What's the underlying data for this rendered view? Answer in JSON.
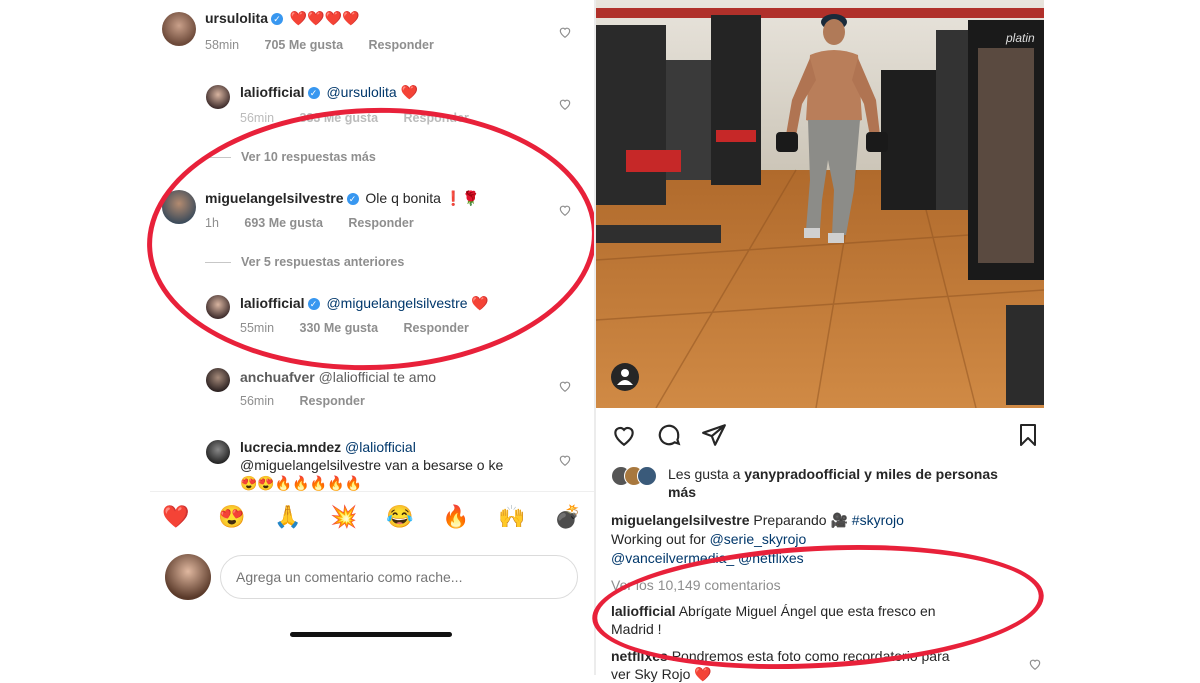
{
  "left": {
    "comments": [
      {
        "user": "ursulolita",
        "text": "❤️❤️❤️❤️",
        "time": "58min",
        "likes": "705 Me gusta",
        "reply": "Responder"
      },
      {
        "user": "laliofficial",
        "mention": "@ursulolita",
        "text": "❤️",
        "time": "56min",
        "likes": "333 Me gusta",
        "reply": "Responder"
      },
      {
        "user": "miguelangelsilvestre",
        "text": "Ole q bonita ❗🌹",
        "time": "1h",
        "likes": "693 Me gusta",
        "reply": "Responder"
      },
      {
        "user": "laliofficial",
        "mention": "@miguelangelsilvestre",
        "text": "❤️",
        "time": "55min",
        "likes": "330 Me gusta",
        "reply": "Responder"
      },
      {
        "user": "anchuafver",
        "text": "@laliofficial te amo",
        "time": "56min",
        "reply": "Responder"
      },
      {
        "user": "lucrecia.mndez",
        "mention": "@laliofficial",
        "line2": "@miguelangelsilvestre van a besarse o ke",
        "line3": "😍😍🔥🔥🔥🔥🔥"
      }
    ],
    "view_more_1": "Ver 10 respuestas más",
    "view_more_2": "Ver 5 respuestas anteriores",
    "emoji_bar": [
      "❤️",
      "😍",
      "🙏",
      "💥",
      "😂",
      "🔥",
      "🙌",
      "💣"
    ],
    "comment_input": {
      "placeholder": "Agrega un comentario como rache..."
    }
  },
  "right": {
    "liked_by_prefix": "Les gusta a ",
    "liked_by_user": "yanypradoofficial",
    "liked_by_suffix": " y miles de personas",
    "liked_by_line2": "más",
    "caption_user": "miguelangelsilvestre",
    "caption_text": "Preparando 🎥",
    "caption_hashtag": "#skyrojo",
    "caption_line2_prefix": "Working out for ",
    "caption_line2_mention": "@serie_skyrojo",
    "caption_line3_mention1": "@vanceilvermedia_",
    "caption_line3_mention2": "@netflixes",
    "view_comments": "Ver los 10,149 comentarios",
    "comment1_user": "laliofficial",
    "comment1_text": "Abrígate Miguel Ángel que esta fresco en",
    "comment1_line2": "Madrid !",
    "comment2_user": "netflixes",
    "comment2_text": "Pondremos esta foto como recordatorio para",
    "comment2_line2": "ver Sky Rojo ❤️",
    "gym_sign": "platin"
  },
  "colors": {
    "accent_red": "#e8213a",
    "verified_blue": "#3897f0",
    "mention_blue": "#00376b",
    "heart_red": "#ed4956"
  }
}
